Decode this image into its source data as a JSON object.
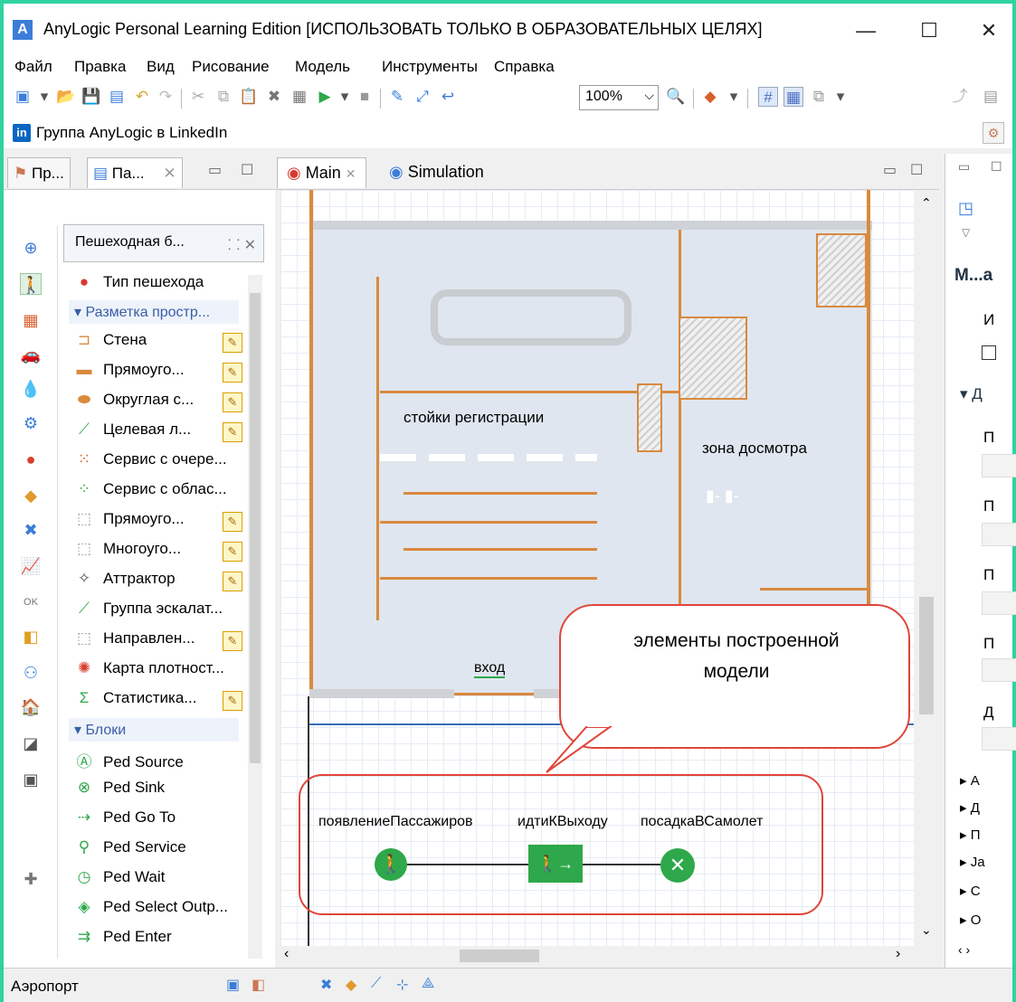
{
  "window": {
    "title": "AnyLogic Personal Learning Edition [ИСПОЛЬЗОВАТЬ ТОЛЬКО В ОБРАЗОВАТЕЛЬНЫХ ЦЕЛЯХ]",
    "minimize": "—",
    "maximize": "☐",
    "close": "✕"
  },
  "menu": [
    "Файл",
    "Правка",
    "Вид",
    "Рисование",
    "Модель",
    "Инструменты",
    "Справка"
  ],
  "toolbar": {
    "zoom": "100%"
  },
  "linkbar": {
    "label": "Группа AnyLogic в LinkedIn",
    "icon": "linkedin-icon"
  },
  "left_tabs": [
    {
      "label": "Пр...",
      "icon": "projects-icon"
    },
    {
      "label": "Па...",
      "icon": "palette-icon",
      "close": "✕"
    }
  ],
  "palette": {
    "header": "Пешеходная б...",
    "items_top": [
      {
        "label": "Тип пешехода",
        "icon": "pedestrian-type-icon",
        "editable": false
      }
    ],
    "section_markup": "Разметка простр...",
    "markup_items": [
      {
        "label": "Стена",
        "icon": "wall-icon",
        "editable": true
      },
      {
        "label": "Прямоуго...",
        "icon": "rect-wall-icon",
        "editable": true
      },
      {
        "label": "Округлая с...",
        "icon": "round-wall-icon",
        "editable": true
      },
      {
        "label": "Целевая л...",
        "icon": "target-line-icon",
        "editable": true
      },
      {
        "label": "Сервис с очере...",
        "icon": "queue-service-icon",
        "editable": false
      },
      {
        "label": "Сервис с облас...",
        "icon": "area-service-icon",
        "editable": false
      },
      {
        "label": "Прямоуго...",
        "icon": "rect-area-icon",
        "editable": true
      },
      {
        "label": "Многоуго...",
        "icon": "polygon-area-icon",
        "editable": true
      },
      {
        "label": "Аттрактор",
        "icon": "attractor-icon",
        "editable": true
      },
      {
        "label": "Группа эскалат...",
        "icon": "escalator-icon",
        "editable": false
      },
      {
        "label": "Направлен...",
        "icon": "direction-icon",
        "editable": true
      },
      {
        "label": "Карта плотност...",
        "icon": "density-map-icon",
        "editable": false
      },
      {
        "label": "Статистика...",
        "icon": "statistics-icon",
        "editable": true
      }
    ],
    "section_blocks": "Блоки",
    "block_items": [
      {
        "label": "Ped Source",
        "icon": "ped-source-icon"
      },
      {
        "label": "Ped Sink",
        "icon": "ped-sink-icon"
      },
      {
        "label": "Ped Go To",
        "icon": "ped-goto-icon"
      },
      {
        "label": "Ped Service",
        "icon": "ped-service-icon"
      },
      {
        "label": "Ped Wait",
        "icon": "ped-wait-icon"
      },
      {
        "label": "Ped Select Outp...",
        "icon": "ped-select-output-icon"
      },
      {
        "label": "Ped Enter",
        "icon": "ped-enter-icon"
      }
    ]
  },
  "editor_tabs": [
    {
      "label": "Main",
      "icon": "agent-icon",
      "close": "✕"
    },
    {
      "label": "Simulation",
      "icon": "experiment-icon"
    }
  ],
  "canvas": {
    "label_checkin": "стойки регистрации",
    "label_security": "зона досмотра",
    "label_entrance": "вход",
    "callout": [
      "элементы построенной",
      "модели"
    ],
    "flow": [
      {
        "label": "появлениеПассажиров",
        "kind": "source"
      },
      {
        "label": "идтиКВыходу",
        "kind": "goto"
      },
      {
        "label": "посадкаВСамолет",
        "kind": "sink"
      }
    ]
  },
  "right_panel": {
    "title": "М...а",
    "rows": [
      "И",
      "Д",
      "П",
      "П",
      "П",
      "П",
      "Д"
    ],
    "collapsed": [
      "А",
      "Д",
      "П",
      "Ja",
      "С",
      "О"
    ]
  },
  "status": {
    "text": "Аэропорт"
  },
  "colors": {
    "frame": "#2fd3a0",
    "wall": "#d98a3e",
    "callout": "#e0453a",
    "ped_green": "#2ea84a"
  }
}
